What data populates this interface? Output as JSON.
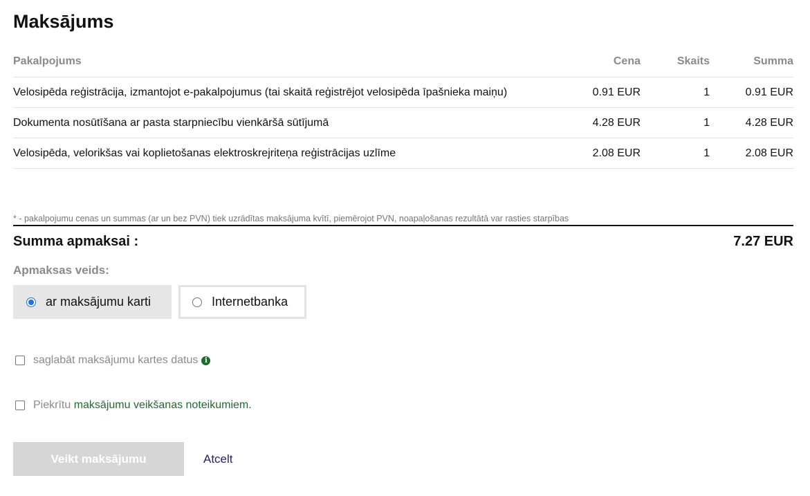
{
  "page": {
    "title": "Maksājums"
  },
  "table": {
    "headers": {
      "service": "Pakalpojums",
      "price": "Cena",
      "count": "Skaits",
      "sum": "Summa"
    },
    "rows": [
      {
        "service": "Velosipēda reģistrācija, izmantojot e-pakalpojumus (tai skaitā reģistrējot velosipēda īpašnieka maiņu)",
        "price": "0.91 EUR",
        "count": "1",
        "sum": "0.91 EUR"
      },
      {
        "service": "Dokumenta nosūtīšana ar pasta starpniecību vienkāršā sūtījumā",
        "price": "4.28 EUR",
        "count": "1",
        "sum": "4.28 EUR"
      },
      {
        "service": "Velosipēda, velorikšas vai koplietošanas elektroskrejriteņa reģistrācijas uzlīme",
        "price": "2.08 EUR",
        "count": "1",
        "sum": "2.08 EUR"
      }
    ]
  },
  "footnote": "* - pakalpojumu cenas un summas (ar un bez PVN) tiek uzrādītas maksājuma kvītī, piemērojot PVN, noapaļošanas rezultātā var rasties starpības",
  "total": {
    "label": "Summa apmaksai :",
    "value": "7.27 EUR"
  },
  "payment": {
    "label": "Apmaksas veids:",
    "options": [
      {
        "label": "ar maksājumu karti",
        "selected": true
      },
      {
        "label": "Internetbanka",
        "selected": false
      }
    ]
  },
  "save_card": {
    "label": "saglabāt maksājumu kartes datus",
    "checked": false
  },
  "agree": {
    "prefix": "Piekrītu ",
    "link": "maksājumu veikšanas noteikumiem",
    "suffix": ".",
    "checked": false
  },
  "actions": {
    "pay_label": "Veikt maksājumu",
    "cancel_label": "Atcelt"
  },
  "colors": {
    "accent_green": "#1e6b2e",
    "radio_blue": "#1a73e8",
    "cancel_link": "#2a1a6e",
    "disabled_button": "#d6d6d6"
  }
}
